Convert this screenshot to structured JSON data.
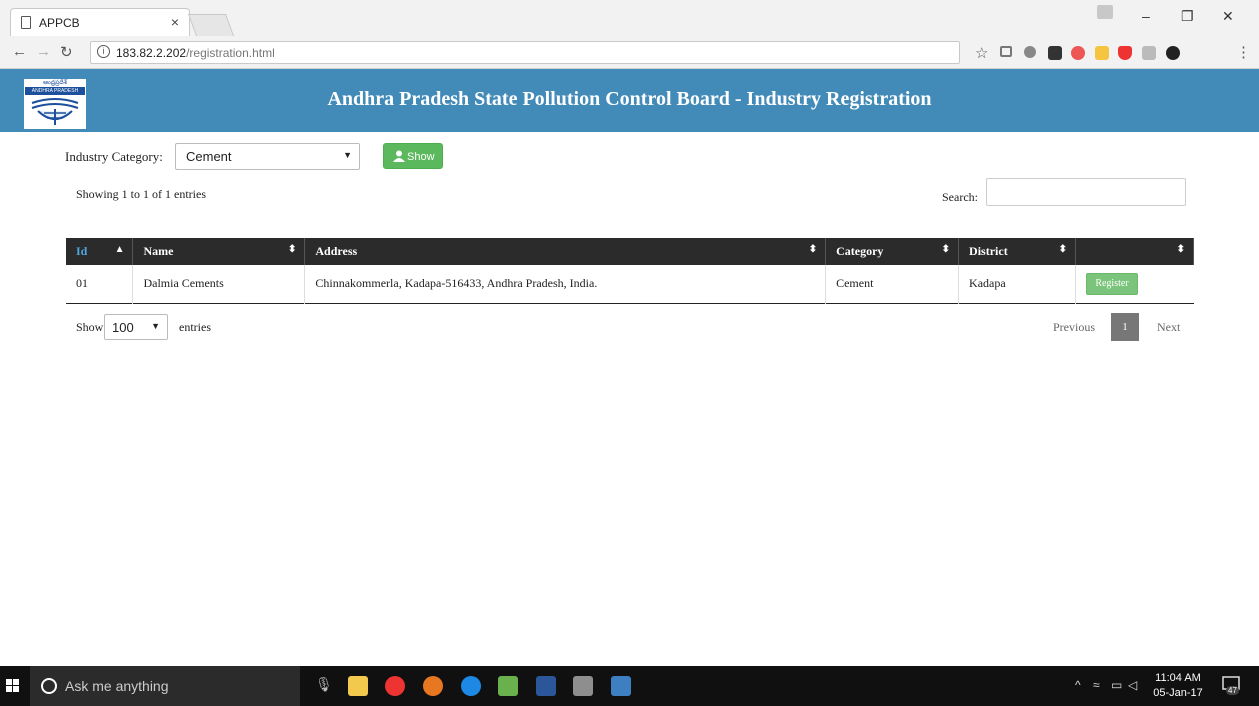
{
  "browser": {
    "tab_title": "APPCB",
    "tab_close": "×",
    "url_host": "183.82.2.202",
    "url_path": "/registration.html",
    "info_icon": "i"
  },
  "header": {
    "logo_text_top": "ఆంధ్రప్రదేశ్",
    "logo_text_bottom": "ANDHRA PRADESH",
    "title": "Andhra Pradesh State Pollution Control Board - Industry Registration"
  },
  "filter": {
    "label": "Industry Category:",
    "selected": "Cement",
    "show_button": "Show"
  },
  "table_info": {
    "showing": "Showing 1 to 1 of 1 entries",
    "search_label": "Search:",
    "search_value": ""
  },
  "table": {
    "columns": [
      "Id",
      "Name",
      "Address",
      "Category",
      "District",
      ""
    ],
    "rows": [
      {
        "id": "01",
        "name": "Dalmia Cements",
        "address": "Chinnakommerla, Kadapa-516433, Andhra Pradesh, India.",
        "category": "Cement",
        "district": "Kadapa",
        "action": "Register"
      }
    ]
  },
  "pagination": {
    "show_label": "Show",
    "length_value": "100",
    "entries_label": "entries",
    "previous": "Previous",
    "current_page": "1",
    "next": "Next"
  },
  "taskbar": {
    "search_placeholder": "Ask me anything",
    "time": "11:04 AM",
    "date": "05-Jan-17",
    "notification_count": "47"
  },
  "colors": {
    "header_bg": "#428bb9",
    "show_button": "#5cb85c",
    "register_button": "#7bc47b",
    "table_header": "#2b2b2b"
  }
}
